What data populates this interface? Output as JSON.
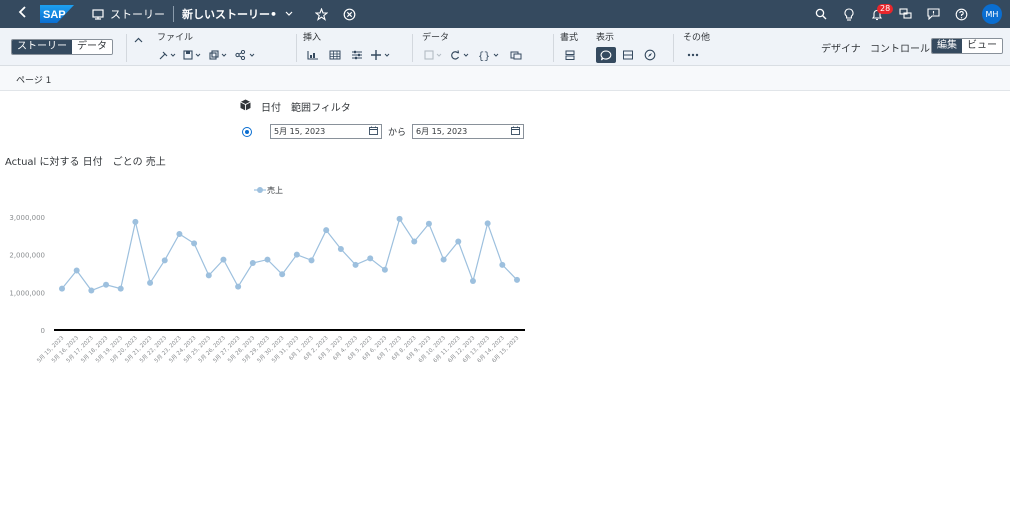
{
  "shell": {
    "story_label": "ストーリー",
    "story_title": "新しいストーリー•",
    "notification_count": "28",
    "avatar_initials": "MH",
    "colors": {
      "shell_bg": "#354a5f",
      "accent": "#0a6ed1",
      "badge": "#e9262c"
    }
  },
  "toolbar": {
    "mode_tabs": [
      "ストーリー",
      "データ"
    ],
    "groups": {
      "file": "ファイル",
      "insert": "挿入",
      "data": "データ",
      "format": "書式",
      "display": "表示",
      "other": "その他"
    },
    "designer_label": "デザイナ",
    "control_label": "コントロール",
    "edit_label": "編集",
    "view_label": "ビュー"
  },
  "page_tabs": {
    "page1": "ページ 1"
  },
  "filter": {
    "title": "日付",
    "subtitle": "範囲フィルタ",
    "from_date": "5月 15, 2023",
    "to_label": "から",
    "to_date": "6月 15, 2023"
  },
  "chart_title": "Actual に対する 日付　ごとの 売上",
  "chart_data": {
    "type": "line",
    "title": "Actual に対する 日付　ごとの 売上",
    "legend": [
      "売上"
    ],
    "legend_position": "top",
    "line_color": "#9dc0de",
    "ylim": [
      0,
      3000000
    ],
    "yticks": [
      "0",
      "1,000,000",
      "2,000,000",
      "3,000,000"
    ],
    "grid": false,
    "categories": [
      "5月 15, 2023",
      "5月 16, 2023",
      "5月 17, 2023",
      "5月 18, 2023",
      "5月 19, 2023",
      "5月 20, 2023",
      "5月 21, 2023",
      "5月 22, 2023",
      "5月 23, 2023",
      "5月 24, 2023",
      "5月 25, 2023",
      "5月 26, 2023",
      "5月 27, 2023",
      "5月 28, 2023",
      "5月 29, 2023",
      "5月 30, 2023",
      "5月 31, 2023",
      "6月 1, 2023",
      "6月 2, 2023",
      "6月 3, 2023",
      "6月 4, 2023",
      "6月 5, 2023",
      "6月 6, 2023",
      "6月 7, 2023",
      "6月 8, 2023",
      "6月 9, 2023",
      "6月 10, 2023",
      "6月 11, 2023",
      "6月 12, 2023",
      "6月 13, 2023",
      "6月 14, 2023",
      "6月 15, 2023"
    ],
    "series": [
      {
        "name": "売上",
        "values": [
          1100000,
          1580000,
          1050000,
          1200000,
          1100000,
          2870000,
          1250000,
          1850000,
          2550000,
          2300000,
          1450000,
          1870000,
          1150000,
          1780000,
          1870000,
          1480000,
          2000000,
          1850000,
          2650000,
          2150000,
          1730000,
          1900000,
          1600000,
          2950000,
          2350000,
          2820000,
          1870000,
          2350000,
          1300000,
          2830000,
          1730000,
          1330000
        ]
      }
    ]
  }
}
